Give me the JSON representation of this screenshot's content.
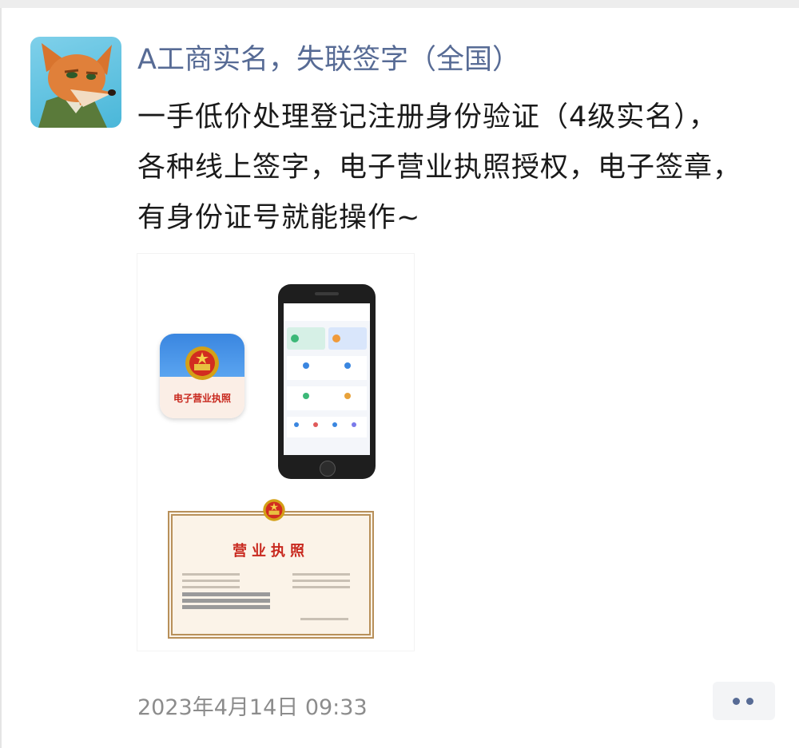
{
  "post": {
    "author": "A工商实名，失联签字（全国）",
    "text": "一手低价处理登记注册身份验证（4级实名），各种线上签字，电子营业执照授权，电子签章，有身份证号就能操作~",
    "timestamp": "2023年4月14日 09:33",
    "image": {
      "app_icon_label": "电子营业执照",
      "license_title": "营业执照"
    }
  },
  "icons": {
    "avatar": "fox-cartoon-avatar",
    "more": "more-dots-icon",
    "emblem": "national-emblem-icon"
  },
  "colors": {
    "author": "#576b95",
    "text": "#1a1a1a",
    "timestamp": "#8c8c8c",
    "license_red": "#c8281e"
  }
}
